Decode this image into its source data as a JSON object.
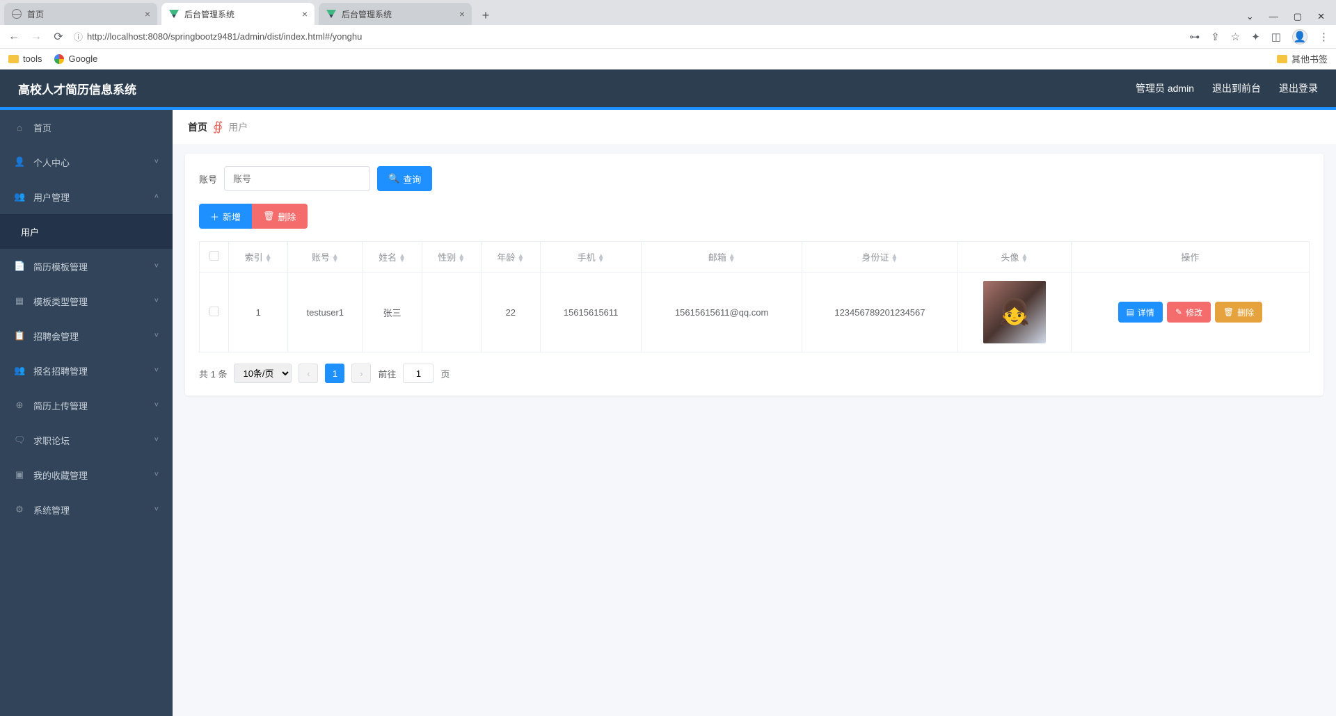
{
  "browser": {
    "tabs": [
      {
        "label": "首页",
        "active": false
      },
      {
        "label": "后台管理系统",
        "active": true
      },
      {
        "label": "后台管理系统",
        "active": false
      }
    ],
    "url": "http://localhost:8080/springbootz9481/admin/dist/index.html#/yonghu",
    "bookmarks": {
      "tools": "tools",
      "google": "Google",
      "other": "其他书签"
    }
  },
  "header": {
    "title": "高校人才简历信息系统",
    "user": "管理员 admin",
    "exitFront": "退出到前台",
    "logout": "退出登录"
  },
  "sidebar": {
    "items": [
      {
        "label": "首页",
        "icon": "home-icon",
        "expandable": false
      },
      {
        "label": "个人中心",
        "icon": "user-icon",
        "expandable": true
      },
      {
        "label": "用户管理",
        "icon": "users-icon",
        "expandable": true,
        "open": true,
        "children": [
          {
            "label": "用户"
          }
        ]
      },
      {
        "label": "简历模板管理",
        "icon": "doc-icon",
        "expandable": true
      },
      {
        "label": "模板类型管理",
        "icon": "grid-icon",
        "expandable": true
      },
      {
        "label": "招聘会管理",
        "icon": "calendar-icon",
        "expandable": true
      },
      {
        "label": "报名招聘管理",
        "icon": "signup-icon",
        "expandable": true
      },
      {
        "label": "简历上传管理",
        "icon": "upload-icon",
        "expandable": true
      },
      {
        "label": "求职论坛",
        "icon": "forum-icon",
        "expandable": true
      },
      {
        "label": "我的收藏管理",
        "icon": "star-icon",
        "expandable": true
      },
      {
        "label": "系统管理",
        "icon": "gear-icon",
        "expandable": true
      }
    ]
  },
  "breadcrumb": {
    "home": "首页",
    "page": "用户"
  },
  "filter": {
    "label": "账号",
    "placeholder": "账号",
    "search": "查询"
  },
  "toolbar": {
    "add": "新增",
    "delete": "删除"
  },
  "table": {
    "columns": [
      "索引",
      "账号",
      "姓名",
      "性别",
      "年龄",
      "手机",
      "邮箱",
      "身份证",
      "头像",
      "操作"
    ],
    "rows": [
      {
        "index": "1",
        "account": "testuser1",
        "name": "张三",
        "gender": "",
        "age": "22",
        "phone": "15615615611",
        "email": "15615615611@qq.com",
        "idcard": "123456789201234567"
      }
    ],
    "actions": {
      "detail": "详情",
      "edit": "修改",
      "delete": "删除"
    }
  },
  "pagination": {
    "total": "共 1 条",
    "perPage": "10条/页",
    "current": "1",
    "gotoLabel": "前往",
    "gotoValue": "1",
    "unit": "页"
  }
}
